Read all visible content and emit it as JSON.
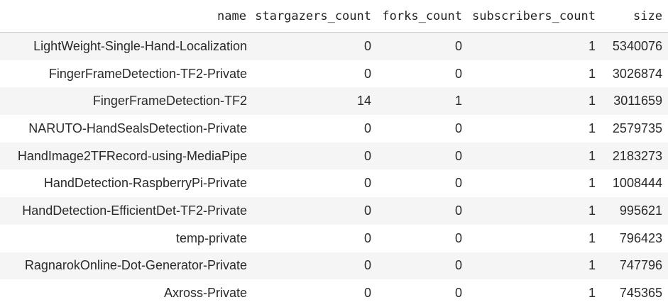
{
  "table": {
    "columns": [
      "name",
      "stargazers_count",
      "forks_count",
      "subscribers_count",
      "size"
    ],
    "rows": [
      [
        "LightWeight-Single-Hand-Localization",
        "0",
        "0",
        "1",
        "5340076"
      ],
      [
        "FingerFrameDetection-TF2-Private",
        "0",
        "0",
        "1",
        "3026874"
      ],
      [
        "FingerFrameDetection-TF2",
        "14",
        "1",
        "1",
        "3011659"
      ],
      [
        "NARUTO-HandSealsDetection-Private",
        "0",
        "0",
        "1",
        "2579735"
      ],
      [
        "HandImage2TFRecord-using-MediaPipe",
        "0",
        "0",
        "1",
        "2183273"
      ],
      [
        "HandDetection-RaspberryPi-Private",
        "0",
        "0",
        "1",
        "1008444"
      ],
      [
        "HandDetection-EfficientDet-TF2-Private",
        "0",
        "0",
        "1",
        "995621"
      ],
      [
        "temp-private",
        "0",
        "0",
        "1",
        "796423"
      ],
      [
        "RagnarokOnline-Dot-Generator-Private",
        "0",
        "0",
        "1",
        "747796"
      ],
      [
        "Axross-Private",
        "0",
        "0",
        "1",
        "745365"
      ]
    ]
  }
}
